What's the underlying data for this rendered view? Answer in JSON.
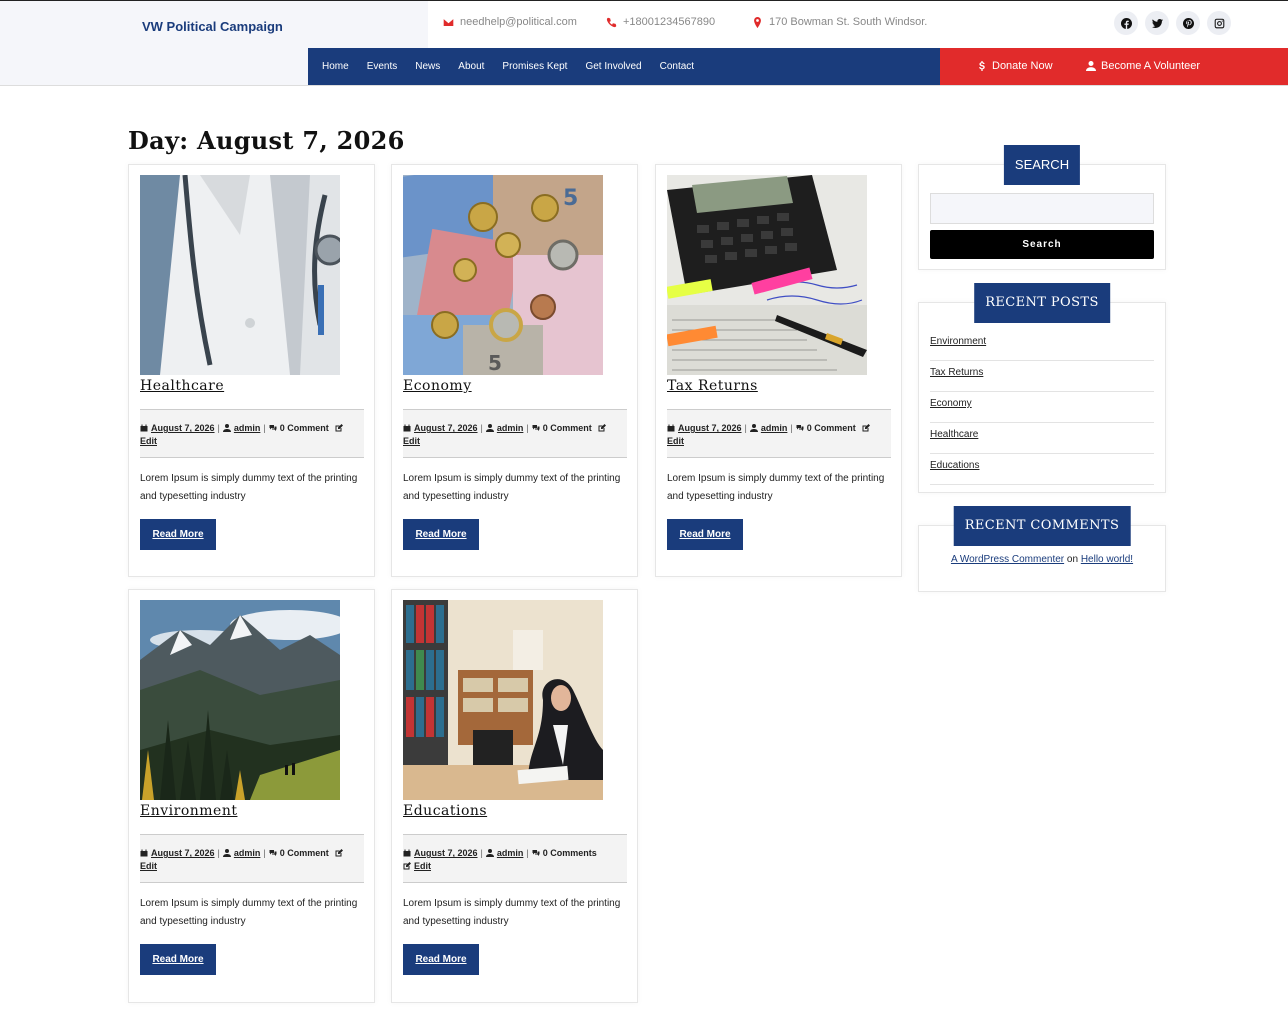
{
  "site": {
    "brand": "VW Political Campaign",
    "email": "needhelp@political.com",
    "phone": "+18001234567890",
    "address": "170 Bowman St. South Windsor."
  },
  "nav": [
    "Home",
    "Events",
    "News",
    "About",
    "Promises Kept",
    "Get Involved",
    "Contact"
  ],
  "cta": {
    "donate": "Donate Now",
    "volunteer": "Become A Volunteer"
  },
  "social": [
    "facebook-icon",
    "twitter-icon",
    "pinterest-icon",
    "instagram-icon"
  ],
  "page_title": "Day: August 7, 2026",
  "posts": [
    {
      "title": "Healthcare",
      "date": "August 7, 2026",
      "author": "admin",
      "comments": "0 Comment",
      "edit": "Edit",
      "excerpt": "Lorem Ipsum is simply dummy text of the printing and typesetting industry",
      "read_more": "Read More"
    },
    {
      "title": "Economy",
      "date": "August 7, 2026",
      "author": "admin",
      "comments": "0 Comment",
      "edit": "Edit",
      "excerpt": "Lorem Ipsum is simply dummy text of the printing and typesetting industry",
      "read_more": "Read More"
    },
    {
      "title": "Tax Returns",
      "date": "August 7, 2026",
      "author": "admin",
      "comments": "0 Comment",
      "edit": "Edit",
      "excerpt": "Lorem Ipsum is simply dummy text of the printing and typesetting industry",
      "read_more": "Read More"
    },
    {
      "title": "Environment",
      "date": "August 7, 2026",
      "author": "admin",
      "comments": "0 Comment",
      "edit": "Edit",
      "excerpt": "Lorem Ipsum is simply dummy text of the printing and typesetting industry",
      "read_more": "Read More"
    },
    {
      "title": "Educations",
      "date": "August 7, 2026",
      "author": "admin",
      "comments": "0 Comments",
      "edit": "Edit",
      "excerpt": "Lorem Ipsum is simply dummy text of the printing and typesetting industry",
      "read_more": "Read More"
    }
  ],
  "sidebar": {
    "search": {
      "title": "SEARCH",
      "button": "Search",
      "placeholder": ""
    },
    "recent_posts": {
      "title": "RECENT POSTS",
      "items": [
        "Environment",
        "Tax Returns",
        "Economy",
        "Healthcare",
        "Educations"
      ]
    },
    "recent_comments": {
      "title": "RECENT COMMENTS",
      "commenter": "A WordPress Commenter",
      "on": "on",
      "post": "Hello world!"
    }
  },
  "colors": {
    "primary": "#1a3c7c",
    "accent": "#e12b2b"
  }
}
